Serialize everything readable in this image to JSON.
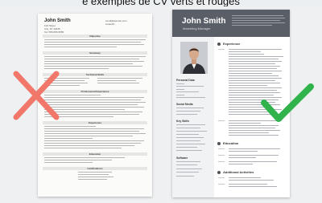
{
  "caption": "e exemples de CV verts et rouges",
  "bad_resume": {
    "name": "John Smith",
    "contact": [
      "123 Street",
      "City, ST 12345",
      "Tel: 555-555-5555"
    ],
    "contact_right": [
      "email@domain.com",
      "LinkedIn"
    ],
    "sections": [
      "Objective",
      "Summary",
      "Technical Skills",
      "Professional Experience",
      "Experience",
      "Education",
      "Certifications"
    ]
  },
  "good_resume": {
    "name": "John Smith",
    "title": "Marketing Manager",
    "sidebar": {
      "personal_data": "Personal Data",
      "social_media": "Social Media",
      "key_skills": "Key Skills",
      "software": "Software"
    },
    "sections": [
      "Experience",
      "Education",
      "Additional Activities"
    ]
  },
  "marks": {
    "bad": "red-x",
    "good": "green-check",
    "bad_color": "#f2776b",
    "good_color": "#2fb34a"
  }
}
